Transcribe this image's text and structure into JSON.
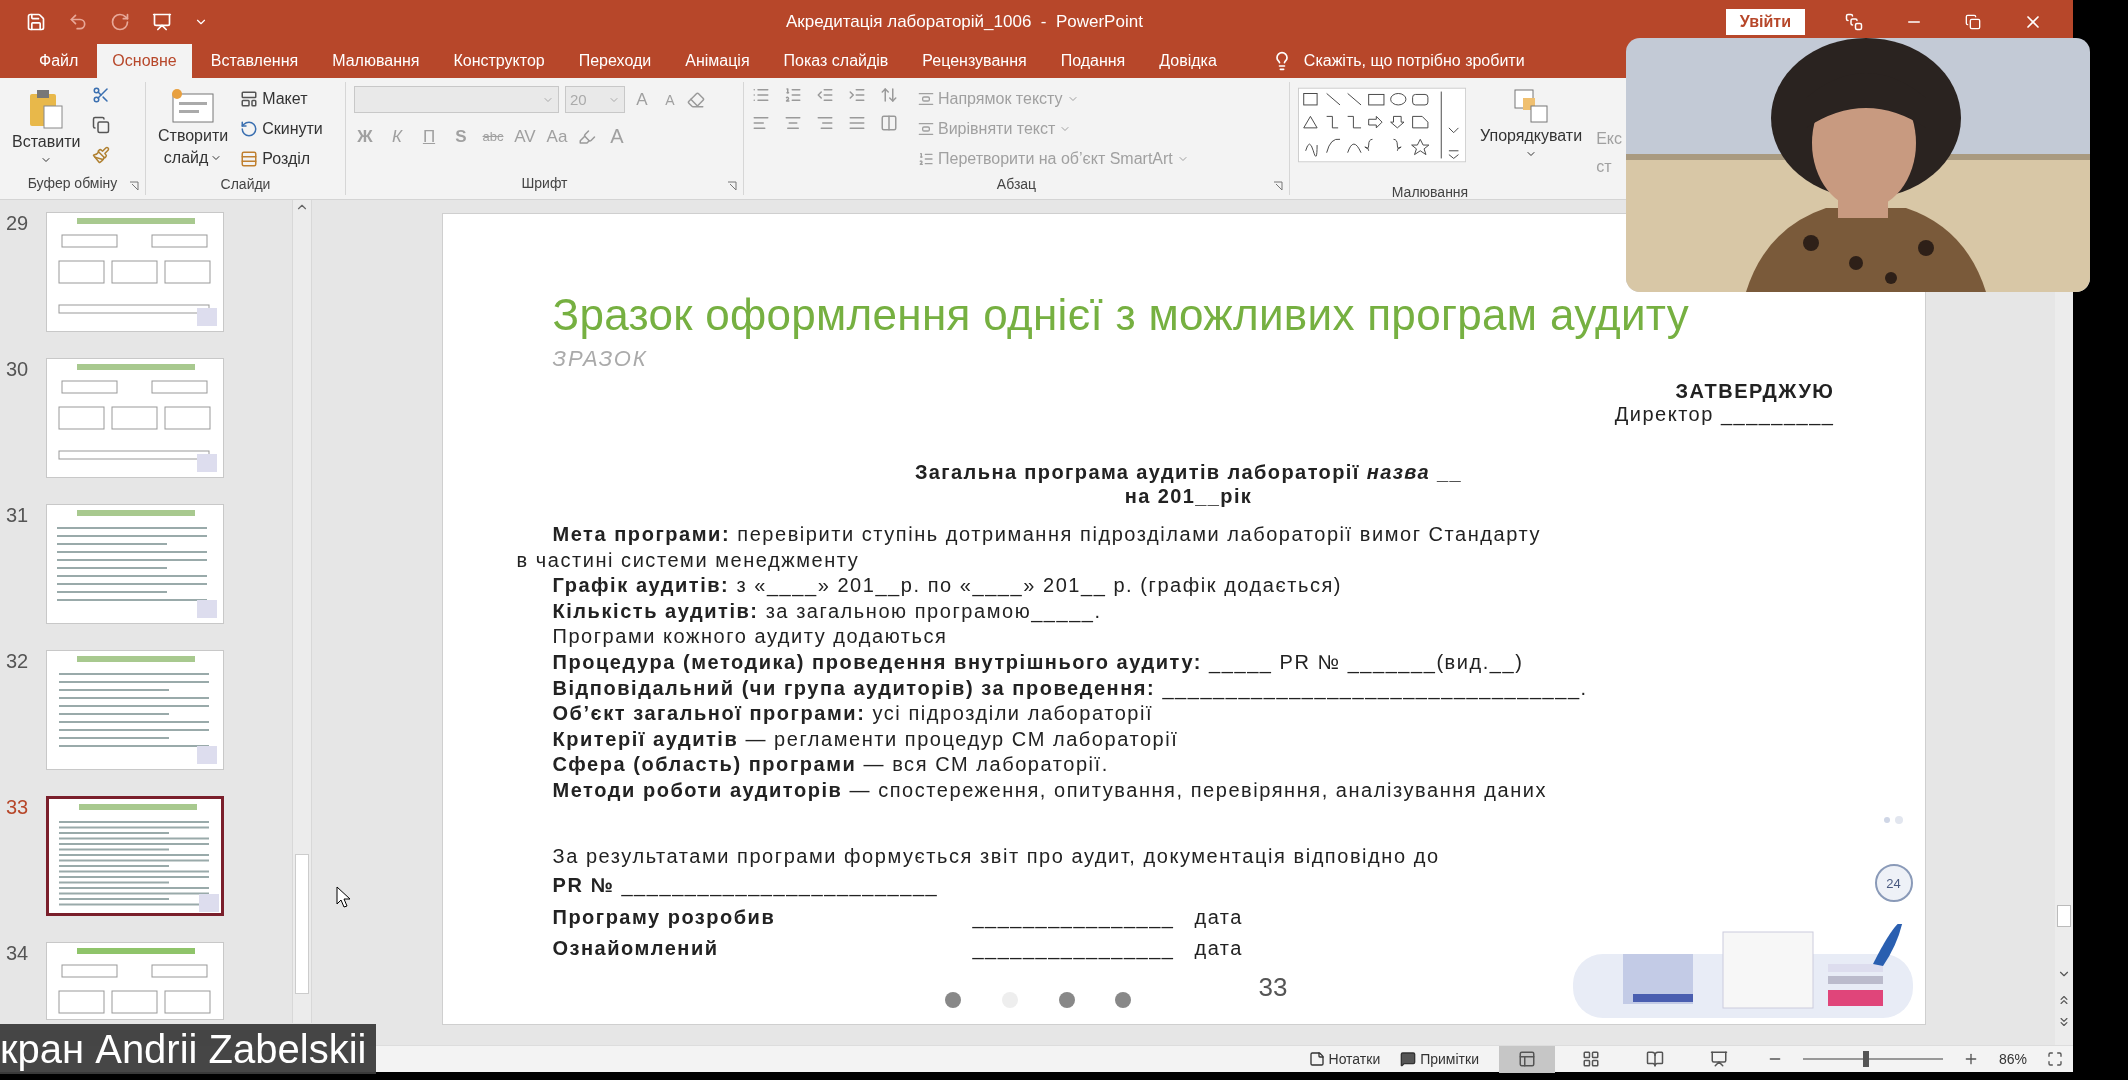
{
  "title_bar": {
    "title": "Акредитація лабораторій_1006  -  PowerPoint",
    "sign_in": "Увійти"
  },
  "tabs": [
    {
      "label": "Файл",
      "selected": false
    },
    {
      "label": "Основне",
      "selected": true
    },
    {
      "label": "Вставлення",
      "selected": false
    },
    {
      "label": "Малювання",
      "selected": false
    },
    {
      "label": "Конструктор",
      "selected": false
    },
    {
      "label": "Переходи",
      "selected": false
    },
    {
      "label": "Анімація",
      "selected": false
    },
    {
      "label": "Показ слайдів",
      "selected": false
    },
    {
      "label": "Рецензування",
      "selected": false
    },
    {
      "label": "Подання",
      "selected": false
    },
    {
      "label": "Довідка",
      "selected": false
    }
  ],
  "tell_me": "Скажіть, що потрібно зробити",
  "ribbon": {
    "clipboard": {
      "paste": "Вставити",
      "label": "Буфер обміну"
    },
    "slides": {
      "new_slide": [
        "Створити",
        "слайд"
      ],
      "layout": "Макет",
      "reset": "Скинути",
      "section": "Розділ",
      "label": "Слайди"
    },
    "font": {
      "size": "20",
      "grow": "A",
      "shrink": "A",
      "formatting": [
        "Ж",
        "К",
        "П",
        "S",
        "abc",
        "AV",
        "Aa"
      ],
      "font_color": "A",
      "label": "Шрифт"
    },
    "paragraph": {
      "text_direction": "Напрямок тексту",
      "align_text": "Вирівняти текст",
      "smartart": "Перетворити на об’єкт SmartArt",
      "label": "Абзац"
    },
    "drawing": {
      "arrange": "Упорядкувати",
      "quick_styles": "Екс",
      "quick_styles_2": "ст",
      "label": "Малювання"
    }
  },
  "thumbnails": [
    {
      "number": "29",
      "selected": false
    },
    {
      "number": "30",
      "selected": false
    },
    {
      "number": "31",
      "selected": false
    },
    {
      "number": "32",
      "selected": false
    },
    {
      "number": "33",
      "selected": true
    },
    {
      "number": "34",
      "selected": false
    }
  ],
  "slide": {
    "title": "Зразок оформлення однієї з можливих програм аудиту",
    "subtitle": "ЗРАЗОК",
    "approve": "ЗАТВЕРДЖУЮ",
    "director": "Директор _________",
    "heading": [
      "Загальна програма аудитів лабораторії *назва* __",
      "на 201__рік"
    ],
    "goal": [
      "**Мета програми:** перевірити ступінь дотримання підрозділами лабораторії вимог Стандарту",
      "в частині системи менеджменту"
    ],
    "items": [
      "**Графік аудитів:** з «____» 201__р. по «____» 201__ р. (графік додається)",
      "**Кількість аудитів:** за загальною програмою_____.",
      "Програми кожного аудиту додаються",
      "**Процедура (методика) проведення внутрішнього аудиту:** _____ PR № _______(вид.__)",
      "**Відповідальний (чи група аудиторів) за проведення:** _________________________________.",
      "**Об’єкт загальної програми:** усі підрозділи лабораторії",
      "**Критерії аудитів** — регламенти процедур СМ лабораторії",
      "**Сфера (область) програми** — вся СМ лабораторії.",
      "**Методи роботи аудиторів** — спостереження, опитування, перевіряння, аналізування даних"
    ],
    "result": "За результатами програми формується звіт про аудит, документація відповідно до",
    "pr": "**PR №** _________________________",
    "signatures": [
      {
        "label": "Програму розробив",
        "line": "________________",
        "date": "дата"
      },
      {
        "label": "Ознайомлений",
        "line": "________________",
        "date": "дата"
      }
    ],
    "badge": "24",
    "number": "33"
  },
  "status_bar": {
    "notes": "Нотатки",
    "comments": "Примітки",
    "views": [
      {
        "kind": "normal",
        "selected": true
      },
      {
        "kind": "sorter",
        "selected": false
      },
      {
        "kind": "reading",
        "selected": false
      },
      {
        "kind": "show",
        "selected": false
      }
    ],
    "zoom": {
      "level": 0.45
    },
    "zoom_text": "86%"
  },
  "name_tag": "кран Andrii Zabelskii"
}
